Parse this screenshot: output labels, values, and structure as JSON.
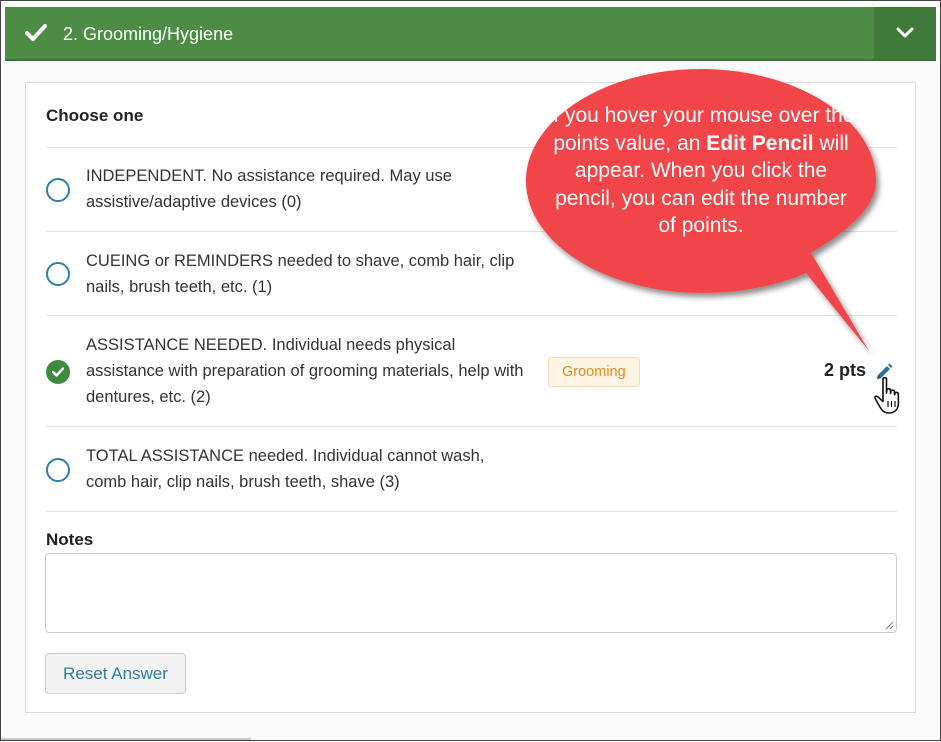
{
  "header": {
    "title": "2. Grooming/Hygiene",
    "icons": {
      "status": "check-icon",
      "toggle": "chevron-down-icon"
    },
    "colors": {
      "bar": "#4c8c44",
      "toggle_bg": "#3f7a38"
    }
  },
  "question": {
    "prompt": "Choose one",
    "options": [
      {
        "text": "INDEPENDENT. No assistance required. May use assistive/adaptive devices (0)",
        "selected": false
      },
      {
        "text": "CUEING or REMINDERS needed to shave, comb hair, clip nails, brush teeth, etc. (1)",
        "selected": false
      },
      {
        "text": "ASSISTANCE NEEDED. Individual needs physical assistance with preparation of grooming materials, help with dentures, etc. (2)",
        "selected": true
      },
      {
        "text": "TOTAL ASSISTANCE needed. Individual cannot wash, comb hair, clip nails, brush teeth, shave (3)",
        "selected": false
      }
    ],
    "selected_tag": "Grooming",
    "points": "2 pts",
    "icons": {
      "edit": "pencil-icon",
      "cursor": "hand-pointer-icon"
    }
  },
  "notes": {
    "label": "Notes",
    "value": "",
    "placeholder": ""
  },
  "actions": {
    "reset_label": "Reset Answer"
  },
  "callout": {
    "text_before": "If you hover your mouse over the points value, an",
    "emphasis": "Edit Pencil",
    "text_after": "will appear. When you click the pencil, you can edit the number of points.",
    "color": "#f2454a"
  }
}
